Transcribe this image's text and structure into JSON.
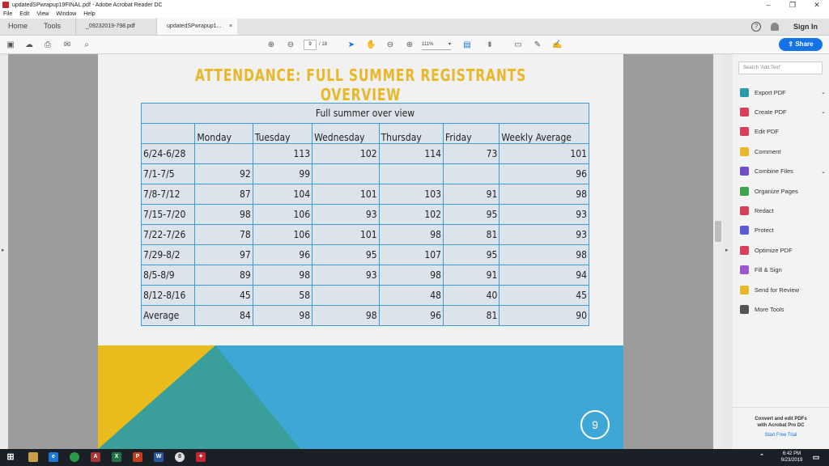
{
  "window": {
    "title": "updatedSPwrapup19FINAL.pdf - Adobe Acrobat Reader DC",
    "minimize": "–",
    "maximize": "❐",
    "close": "✕"
  },
  "menu": [
    "File",
    "Edit",
    "View",
    "Window",
    "Help"
  ],
  "tabs": {
    "home": "Home",
    "tools": "Tools",
    "doc1": "_09232019-798.pdf",
    "doc2": "updatedSPwrapup1...",
    "close": "×"
  },
  "header": {
    "help": "?",
    "sign_in": "Sign In"
  },
  "toolbar": {
    "page_current": "9",
    "page_total": "/ 18",
    "zoom": "111%",
    "zoom_arrow": "▾",
    "share": "Share"
  },
  "slide": {
    "title": "ATTENDANCE: FULL SUMMER REGISTRANTS OVERVIEW",
    "table_caption": "Full summer over view",
    "columns": [
      "",
      "Monday",
      "Tuesday",
      "Wednesday",
      "Thursday",
      "Friday",
      "Weekly Average"
    ],
    "rows": [
      [
        "6/24-6/28",
        "",
        "113",
        "102",
        "114",
        "73",
        "101"
      ],
      [
        "7/1-7/5",
        "92",
        "99",
        "",
        "",
        "",
        "96"
      ],
      [
        "7/8-7/12",
        "87",
        "104",
        "101",
        "103",
        "91",
        "98"
      ],
      [
        "7/15-7/20",
        "98",
        "106",
        "93",
        "102",
        "95",
        "93"
      ],
      [
        "7/22-7/26",
        "78",
        "106",
        "101",
        "98",
        "81",
        "93"
      ],
      [
        "7/29-8/2",
        "97",
        "96",
        "95",
        "107",
        "95",
        "98"
      ],
      [
        "8/5-8/9",
        "89",
        "98",
        "93",
        "98",
        "91",
        "94"
      ],
      [
        "8/12-8/16",
        "45",
        "58",
        "",
        "48",
        "40",
        "45"
      ],
      [
        "Average",
        "84",
        "98",
        "98",
        "96",
        "81",
        "90"
      ]
    ],
    "page_number": "9",
    "colors": {
      "title": "#e8b829",
      "table_bg": "#dde3ea",
      "border": "#3d9bd3",
      "footer_blue": "#3fa7d6",
      "footer_yellow": "#e9bb1c",
      "footer_teal": "#3a9e9b"
    }
  },
  "right_panel": {
    "search_placeholder": "Search 'Add Text'",
    "tools": [
      {
        "label": "Export PDF",
        "icon": "export-pdf-icon",
        "color": "#2b9ba8",
        "chevron": true
      },
      {
        "label": "Create PDF",
        "icon": "create-pdf-icon",
        "color": "#d6405b",
        "chevron": true
      },
      {
        "label": "Edit PDF",
        "icon": "edit-pdf-icon",
        "color": "#d6405b",
        "chevron": false
      },
      {
        "label": "Comment",
        "icon": "comment-icon",
        "color": "#e8b829",
        "chevron": false
      },
      {
        "label": "Combine Files",
        "icon": "combine-files-icon",
        "color": "#6f4fc9",
        "chevron": true
      },
      {
        "label": "Organize Pages",
        "icon": "organize-pages-icon",
        "color": "#3ea54d",
        "chevron": false
      },
      {
        "label": "Redact",
        "icon": "redact-icon",
        "color": "#d6405b",
        "chevron": false
      },
      {
        "label": "Protect",
        "icon": "protect-icon",
        "color": "#5a5bd6",
        "chevron": false
      },
      {
        "label": "Optimize PDF",
        "icon": "optimize-pdf-icon",
        "color": "#d6405b",
        "chevron": false
      },
      {
        "label": "Fill & Sign",
        "icon": "fill-sign-icon",
        "color": "#9b59d0",
        "chevron": false
      },
      {
        "label": "Send for Review",
        "icon": "send-for-review-icon",
        "color": "#e8b829",
        "chevron": false
      },
      {
        "label": "More Tools",
        "icon": "more-tools-icon",
        "color": "#555555",
        "chevron": false
      }
    ],
    "promo_line1": "Convert and edit PDFs",
    "promo_line2": "with Acrobat Pro DC",
    "promo_link": "Start Free Trial"
  },
  "taskbar": {
    "time": "6:42 PM",
    "date": "9/23/2019"
  }
}
